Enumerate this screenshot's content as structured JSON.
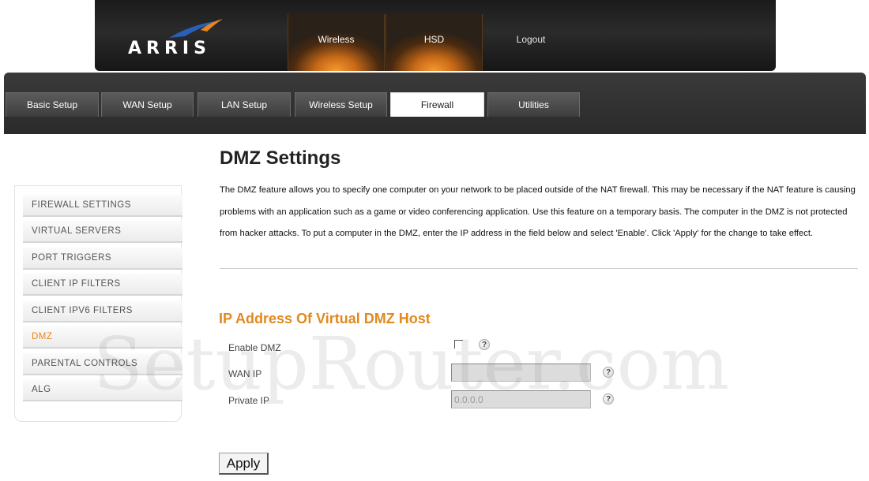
{
  "header": {
    "logo_text": "ARRIS",
    "tabs": [
      {
        "label": "Wireless"
      },
      {
        "label": "HSD"
      },
      {
        "label": "Logout"
      }
    ]
  },
  "subnav": {
    "tabs": [
      {
        "label": "Basic Setup"
      },
      {
        "label": "WAN Setup"
      },
      {
        "label": "LAN Setup"
      },
      {
        "label": "Wireless Setup"
      },
      {
        "label": "Firewall"
      },
      {
        "label": "Utilities"
      }
    ],
    "active": "Firewall"
  },
  "sidebar": {
    "items": [
      {
        "label": "FIREWALL SETTINGS"
      },
      {
        "label": "VIRTUAL SERVERS"
      },
      {
        "label": "PORT TRIGGERS"
      },
      {
        "label": "CLIENT IP FILTERS"
      },
      {
        "label": "CLIENT IPV6 FILTERS"
      },
      {
        "label": "DMZ"
      },
      {
        "label": "PARENTAL CONTROLS"
      },
      {
        "label": "ALG"
      }
    ],
    "active": "DMZ"
  },
  "main": {
    "title": "DMZ Settings",
    "description": "The DMZ feature allows you to specify one computer on your network to be placed outside of the NAT firewall. This may be necessary if the NAT feature is causing problems with an application such as a game or video conferencing application. Use this feature on a temporary basis. The computer in the DMZ is not protected from hacker attacks. To put a computer in the DMZ, enter the IP address in the field below and select 'Enable'. Click 'Apply' for the change to take effect.",
    "section_title": "IP Address Of Virtual DMZ Host",
    "form": {
      "enable_label": "Enable DMZ",
      "enable_checked": false,
      "wan_ip_label": "WAN IP",
      "wan_ip_value": "",
      "private_ip_label": "Private IP",
      "private_ip_value": "0.0.0.0",
      "help_glyph": "?"
    },
    "apply_label": "Apply"
  },
  "watermark": "SetupRouter.com",
  "colors": {
    "accent_orange": "#e08a1e",
    "header_dark": "#222222"
  }
}
